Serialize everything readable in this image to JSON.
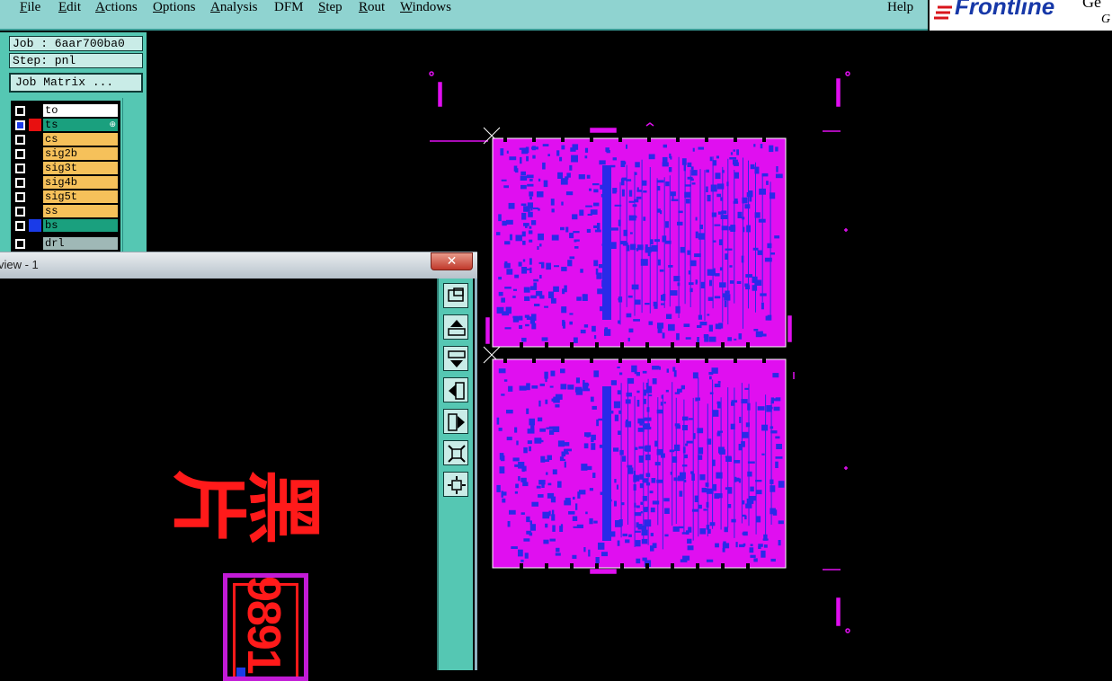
{
  "menu": {
    "items": [
      "File",
      "Edit",
      "Actions",
      "Options",
      "Analysis",
      "DFM",
      "Step",
      "Rout",
      "Windows"
    ],
    "underline": [
      "F",
      "E",
      "A",
      "O",
      "A",
      "",
      "S",
      "R",
      "W"
    ],
    "help": "Help"
  },
  "logo": {
    "text": "Frontline",
    "cut_top": "Ge",
    "cut_bottom": "G"
  },
  "job": {
    "label": "Job : 6aar700ba0",
    "step": "Step: pnl",
    "matrix_button": "Job Matrix ..."
  },
  "layers": [
    {
      "name": "to",
      "color": "#000000",
      "bg": "#ffffff"
    },
    {
      "name": "ts",
      "color": "#e81010",
      "bg": "#1aa07e",
      "checked": true,
      "mark": "⊕"
    },
    {
      "name": "cs",
      "color": "#000000",
      "bg": "#f6c15a"
    },
    {
      "name": "sig2b",
      "color": "#000000",
      "bg": "#f6c15a"
    },
    {
      "name": "sig3t",
      "color": "#000000",
      "bg": "#f6c15a"
    },
    {
      "name": "sig4b",
      "color": "#000000",
      "bg": "#f6c15a"
    },
    {
      "name": "sig5t",
      "color": "#000000",
      "bg": "#f6c15a"
    },
    {
      "name": "ss",
      "color": "#000000",
      "bg": "#f6c15a"
    },
    {
      "name": "bs",
      "color": "#1a3be8",
      "bg": "#1aa07e"
    },
    {
      "name": "drl",
      "color": "#000000",
      "bg": "#9fb8b6"
    }
  ],
  "child_window": {
    "title": "view - 1",
    "close": "✕",
    "toolbar": [
      "zoom-window-icon",
      "pan-up-icon",
      "pan-down-icon",
      "pan-left-icon",
      "pan-right-icon",
      "zoom-in-icon",
      "zoom-out-icon"
    ],
    "preview_text_cn": "黑片",
    "preview_number": "9891"
  },
  "colors": {
    "menu_bg": "#8fd3d0",
    "panel_bg": "#55c7b3",
    "board_copper": "#e00ff0",
    "board_features": "#2a2ae8",
    "canvas_bg": "#000000"
  }
}
